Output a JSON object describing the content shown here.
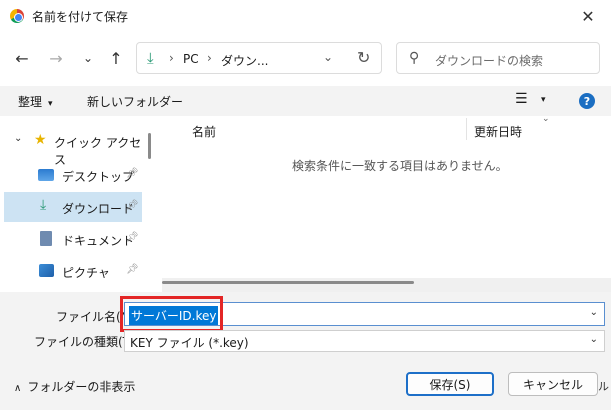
{
  "window": {
    "title": "名前を付けて保存",
    "close_glyph": "✕"
  },
  "nav": {
    "back_glyph": "←",
    "forward_glyph": "→",
    "recent_glyph": "⌄",
    "up_glyph": "↑",
    "breadcrumb": [
      "PC",
      "ダウン..."
    ],
    "breadcrumb_sep": "›",
    "dropdown_glyph": "⌄",
    "refresh_glyph": "↻",
    "search_placeholder": "ダウンロードの検索"
  },
  "toolbar": {
    "organize_label": "整理",
    "new_folder_label": "新しいフォルダー",
    "view_glyph": "☰",
    "caret_glyph": "▾",
    "help_glyph": "?"
  },
  "sidebar": {
    "quick_access_label": "クイック アクセス",
    "items": [
      {
        "label": "デスクトップ",
        "icon": "desktop-icon"
      },
      {
        "label": "ダウンロード",
        "icon": "download-icon",
        "selected": true
      },
      {
        "label": "ドキュメント",
        "icon": "document-icon"
      },
      {
        "label": "ピクチャ",
        "icon": "picture-icon"
      }
    ]
  },
  "filelist": {
    "columns": [
      "名前",
      "更新日時"
    ],
    "empty_message": "検索条件に一致する項目はありません。"
  },
  "form": {
    "filename_label": "ファイル名(N):",
    "filename_value": "サーバーID.key",
    "filetype_label": "ファイルの種類(T):",
    "filetype_value": "KEY ファイル (*.key)"
  },
  "footer": {
    "hide_folders_label": "フォルダーの非表示",
    "save_label": "保存(S)",
    "cancel_label": "キャンセル",
    "cancel_tail": "ル"
  },
  "colors": {
    "accent": "#0078d7",
    "highlight_box": "#e32626",
    "selected_nav": "#cde3f3"
  }
}
